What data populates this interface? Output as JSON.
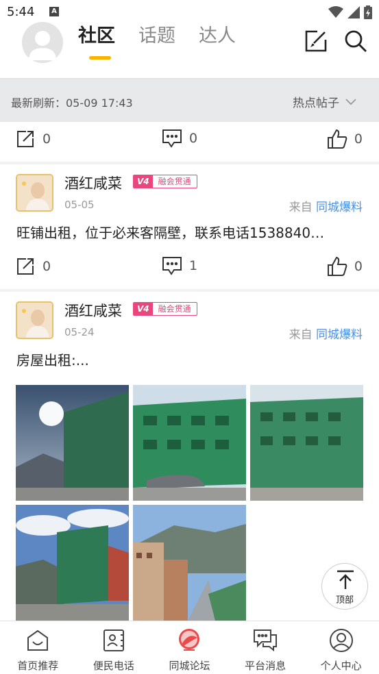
{
  "status_bar": {
    "time": "5:44",
    "a_icon": "A"
  },
  "header": {
    "tabs": [
      {
        "label": "社区",
        "active": true
      },
      {
        "label": "话题",
        "active": false
      },
      {
        "label": "达人",
        "active": false
      }
    ]
  },
  "refresh_bar": {
    "last_refresh_label": "最新刷新：05-09 17:43",
    "sort_label": "热点帖子"
  },
  "posts": [
    {
      "share_count": "0",
      "comment_count": "0",
      "like_count": "0"
    },
    {
      "user": "酒红咸菜",
      "badge_level": "V4",
      "badge_text": "融会贯通",
      "date": "05-05",
      "source_prefix": "来自",
      "source_link": "同城爆料",
      "text": "旺铺出租，位于必来客隔壁，联系电话1538840…",
      "share_count": "0",
      "comment_count": "1",
      "like_count": "0"
    },
    {
      "user": "酒红咸菜",
      "badge_level": "V4",
      "badge_text": "融会贯通",
      "date": "05-24",
      "source_prefix": "来自",
      "source_link": "同城爆料",
      "text": "房屋出租:..."
    }
  ],
  "back_to_top": "顶部",
  "bottom_nav": [
    {
      "label": "首页推荐",
      "icon": "home-icon"
    },
    {
      "label": "便民电话",
      "icon": "contact-book-icon"
    },
    {
      "label": "同城论坛",
      "icon": "forum-icon",
      "active": true
    },
    {
      "label": "平台消息",
      "icon": "message-icon"
    },
    {
      "label": "个人中心",
      "icon": "user-icon"
    }
  ],
  "colors": {
    "accent": "#f7b500",
    "badge": "#e8467c",
    "link": "#4a90e2",
    "active_nav": "#e94a4a"
  }
}
